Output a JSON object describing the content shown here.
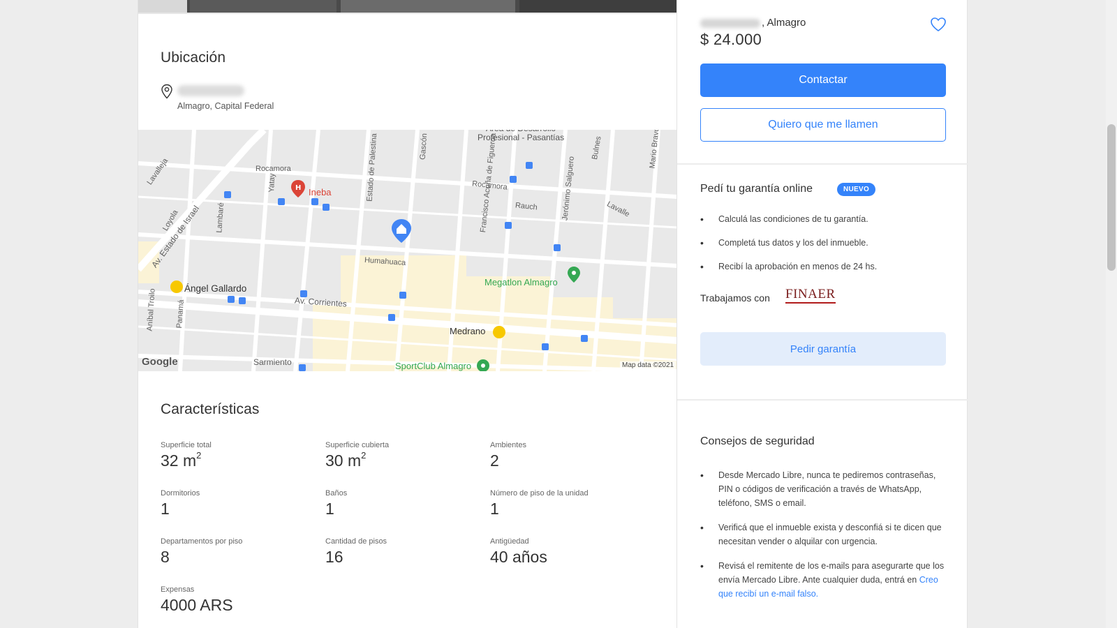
{
  "location": {
    "title": "Ubicación",
    "area": "Almagro, Capital Federal"
  },
  "map": {
    "streets": [
      "Rocamora",
      "Lavalleja",
      "Yatay",
      "Lambaré",
      "Estado de Palestina",
      "Gascón",
      "Francisco Acuña de Figueroa",
      "Jerónimo Salguero",
      "Rauch",
      "Lavalle",
      "Bulnes",
      "Mario Bravo",
      "Humahuaca",
      "Av. Corrientes",
      "Sarmiento",
      "Av. Estado de Israel",
      "Loyola",
      "Aníbal Troilo",
      "Panamá"
    ],
    "pois": {
      "ineba": "Ineba",
      "angel_gallardo": "Ángel Gallardo",
      "megatlon": "Megatlon Almagro",
      "medrano": "Medrano",
      "sportclub": "SportClub Almagro",
      "area": "Área de Desarrollo\nProfesional - Pasantías"
    },
    "google": "Google",
    "map_data": "Map data ©2021"
  },
  "features": {
    "title": "Características",
    "items": [
      {
        "label": "Superficie total",
        "value": "32 m",
        "sup": "2"
      },
      {
        "label": "Superficie cubierta",
        "value": "30 m",
        "sup": "2"
      },
      {
        "label": "Ambientes",
        "value": "2"
      },
      {
        "label": "Dormitorios",
        "value": "1"
      },
      {
        "label": "Baños",
        "value": "1"
      },
      {
        "label": "Número de piso de la unidad",
        "value": "1"
      },
      {
        "label": "Departamentos por piso",
        "value": "8"
      },
      {
        "label": "Cantidad de pisos",
        "value": "16"
      },
      {
        "label": "Antigüedad",
        "value": "40 años"
      },
      {
        "label": "Expensas",
        "value": "4000 ARS"
      }
    ]
  },
  "sidebar": {
    "owner_suffix": ", Almagro",
    "price": "$ 24.000",
    "contact_label": "Contactar",
    "call_me_label": "Quiero que me llamen",
    "guarantee": {
      "title": "Pedí tu garantía online",
      "badge": "NUEVO",
      "bullets": [
        "Calculá las condiciones de tu garantía.",
        "Completá tus datos y los del inmueble.",
        "Recibí la aprobación en menos de 24 hs."
      ],
      "work_with": "Trabajamos con",
      "partner": "FINAER",
      "button": "Pedir garantía"
    },
    "safety": {
      "title": "Consejos de seguridad",
      "bullets": [
        "Desde Mercado Libre, nunca te pediremos contraseñas, PIN o códigos de verificación a través de WhatsApp, teléfono, SMS o email.",
        "Verificá que el inmueble exista y desconfiá si te dicen que necesitan vender o alquilar con urgencia."
      ],
      "bullet3_prefix": "Revisá el remitente de los e-mails para asegurarte que los envía Mercado Libre. Ante cualquier duda, entrá en ",
      "bullet3_link": "Creo que recibí un e-mail falso."
    }
  },
  "colors": {
    "accent": "#3483fa",
    "accent_soft": "#e3edfb",
    "map_pin": "#4285f4",
    "poi_red": "#db4437",
    "poi_green": "#34a853"
  }
}
